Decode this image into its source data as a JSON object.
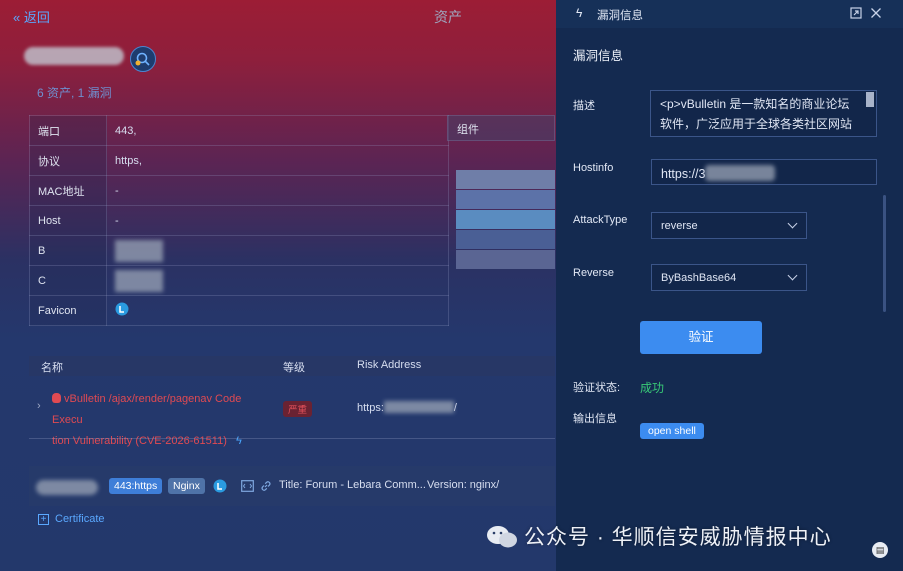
{
  "header": {
    "back_label": "返回",
    "title": "资产"
  },
  "host": {
    "summary": "6 资产, 1 漏洞"
  },
  "info_rows": [
    {
      "key": "端口",
      "value": "443,"
    },
    {
      "key": "协议",
      "value": "https,"
    },
    {
      "key": "MAC地址",
      "value": "-"
    },
    {
      "key": "Host",
      "value": "-"
    },
    {
      "key": "B",
      "value": ""
    },
    {
      "key": "C",
      "value": ""
    },
    {
      "key": "Favicon",
      "value": ""
    }
  ],
  "components": {
    "header": "组件"
  },
  "vuln_table": {
    "columns": {
      "name": "名称",
      "level": "等级",
      "risk_address": "Risk Address"
    },
    "row": {
      "name_line1": "vBulletin /ajax/render/pagenav Code Execu",
      "name_line2": "tion Vulnerability (CVE-2026-61511)",
      "level": "严重",
      "address_prefix": "https:",
      "address_suffix": "/"
    }
  },
  "asset_bar": {
    "tag_port": "443:https",
    "tag_server": "Nginx",
    "title_text": "Title: Forum - Lebara Comm...",
    "version_text": "Version: nginx/"
  },
  "certificate": {
    "label": "Certificate"
  },
  "panel": {
    "header_title": "漏洞信息",
    "section_title": "漏洞信息",
    "desc_label": "描述",
    "desc_text": "<p>vBulletin 是一款知名的商业论坛软件，广泛应用于全球各类社区网站和在线讨论平台，由vBulletin Solutions开发。",
    "hostinfo_label": "Hostinfo",
    "hostinfo_prefix": "https://3",
    "attacktype_label": "AttackType",
    "attacktype_value": "reverse",
    "reverse_label": "Reverse",
    "reverse_value": "ByBashBase64",
    "verify_button": "验证",
    "status_label": "验证状态:",
    "status_value": "成功",
    "output_label": "输出信息",
    "open_shell": "open shell"
  },
  "watermark": "公众号 · 华顺信安威胁情报中心",
  "colors": {
    "accent": "#3c8cf0",
    "danger": "#e04a52",
    "success": "#38c977",
    "panel_bg": "#142a50"
  },
  "icons": [
    "double-chevron-left-icon",
    "lightning-icon",
    "expand-icon",
    "close-icon",
    "bug-icon",
    "chevron-right-icon",
    "plus-square-icon",
    "link-icon",
    "code-icon",
    "favicon-icon",
    "fingerprint-icon",
    "wechat-icon"
  ]
}
